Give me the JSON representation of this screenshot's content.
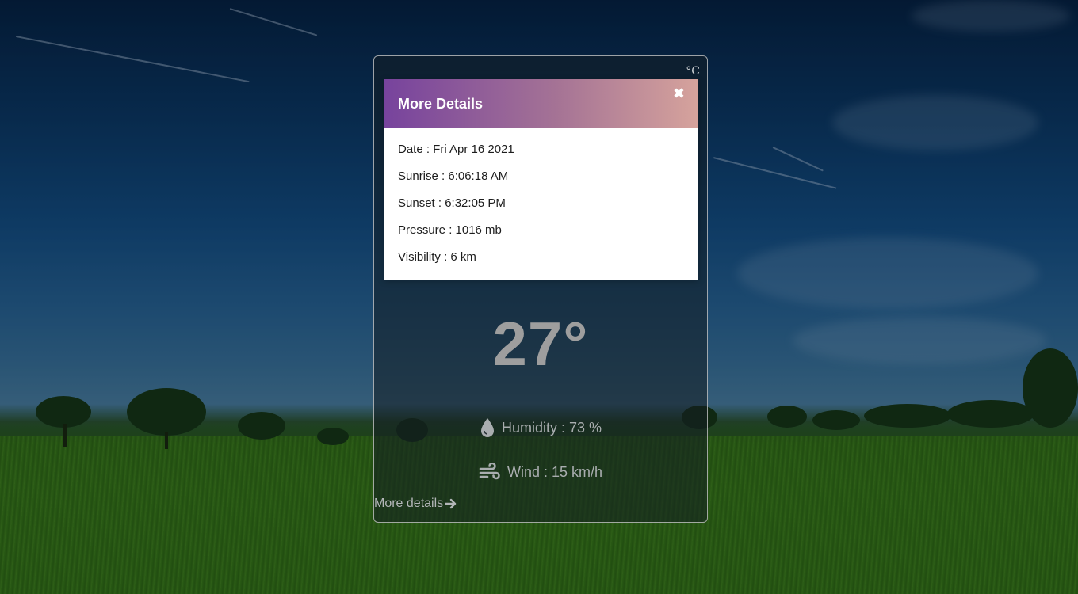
{
  "card": {
    "unit_label": "°C",
    "temperature": "27°",
    "humidity": {
      "icon": "water-drop-icon",
      "label": "Humidity : 73 %"
    },
    "wind": {
      "icon": "wind-icon",
      "label": "Wind : 15 km/h"
    },
    "more_details_label": "More details",
    "more_details_icon": "arrow-right-icon"
  },
  "modal": {
    "title": "More Details",
    "close_icon": "close-icon",
    "details": [
      {
        "label": "Date : Fri Apr 16 2021"
      },
      {
        "label": "Sunrise : 6:06:18 AM"
      },
      {
        "label": "Sunset : 6:32:05 PM"
      },
      {
        "label": "Pressure : 1016 mb"
      },
      {
        "label": "Visibility : 6 km"
      }
    ]
  },
  "colors": {
    "modal_gradient_start": "#77439d",
    "modal_gradient_end": "#d6a39c",
    "card_text": "#a9adaf"
  }
}
